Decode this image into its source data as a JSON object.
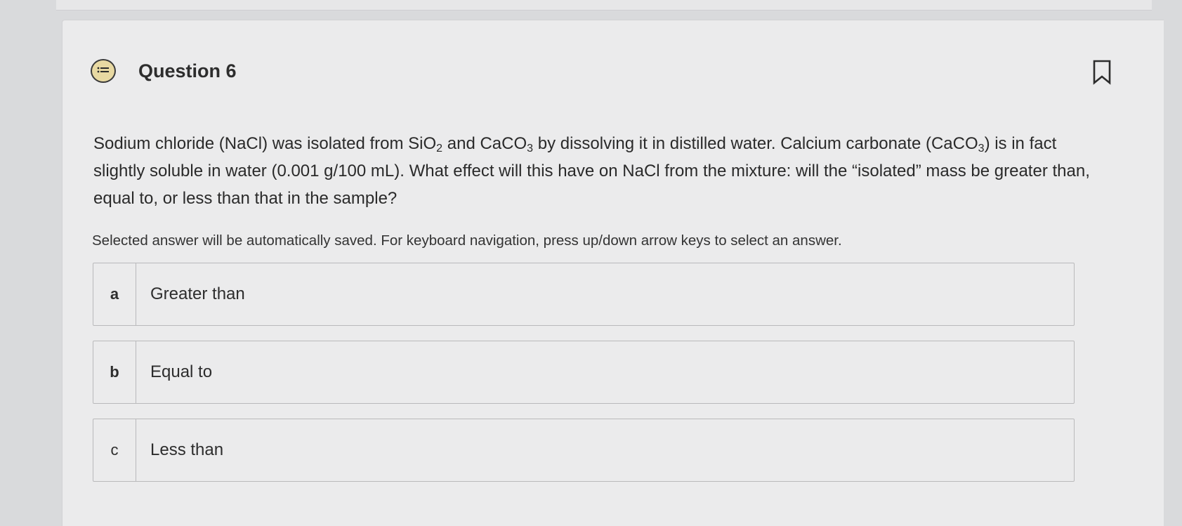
{
  "question": {
    "title": "Question 6",
    "icon": "question-list-icon",
    "bookmark_icon": "bookmark-icon",
    "prompt_parts": {
      "p1": "Sodium chloride (NaCl) was isolated from SiO",
      "sub1": "2",
      "p2": " and CaCO",
      "sub2": "3",
      "p3": " by dissolving it in distilled water. Calcium carbonate (CaCO",
      "sub3": "3",
      "p4": ") is in fact slightly soluble in water (0.001 g/100 mL). What effect will this have on NaCl from the mixture: will the “isolated” mass  be greater than, equal to, or less than that in the sample?"
    },
    "instructions": "Selected answer will be automatically saved. For keyboard navigation, press up/down arrow keys to select an answer."
  },
  "options": [
    {
      "letter": "a",
      "label": "Greater than"
    },
    {
      "letter": "b",
      "label": "Equal to"
    },
    {
      "letter": "c",
      "label": "Less than"
    }
  ],
  "colors": {
    "background": "#d9dadc",
    "card": "#ebebec",
    "icon_fill": "#e8d9a2",
    "border": "#b9b9bb"
  }
}
